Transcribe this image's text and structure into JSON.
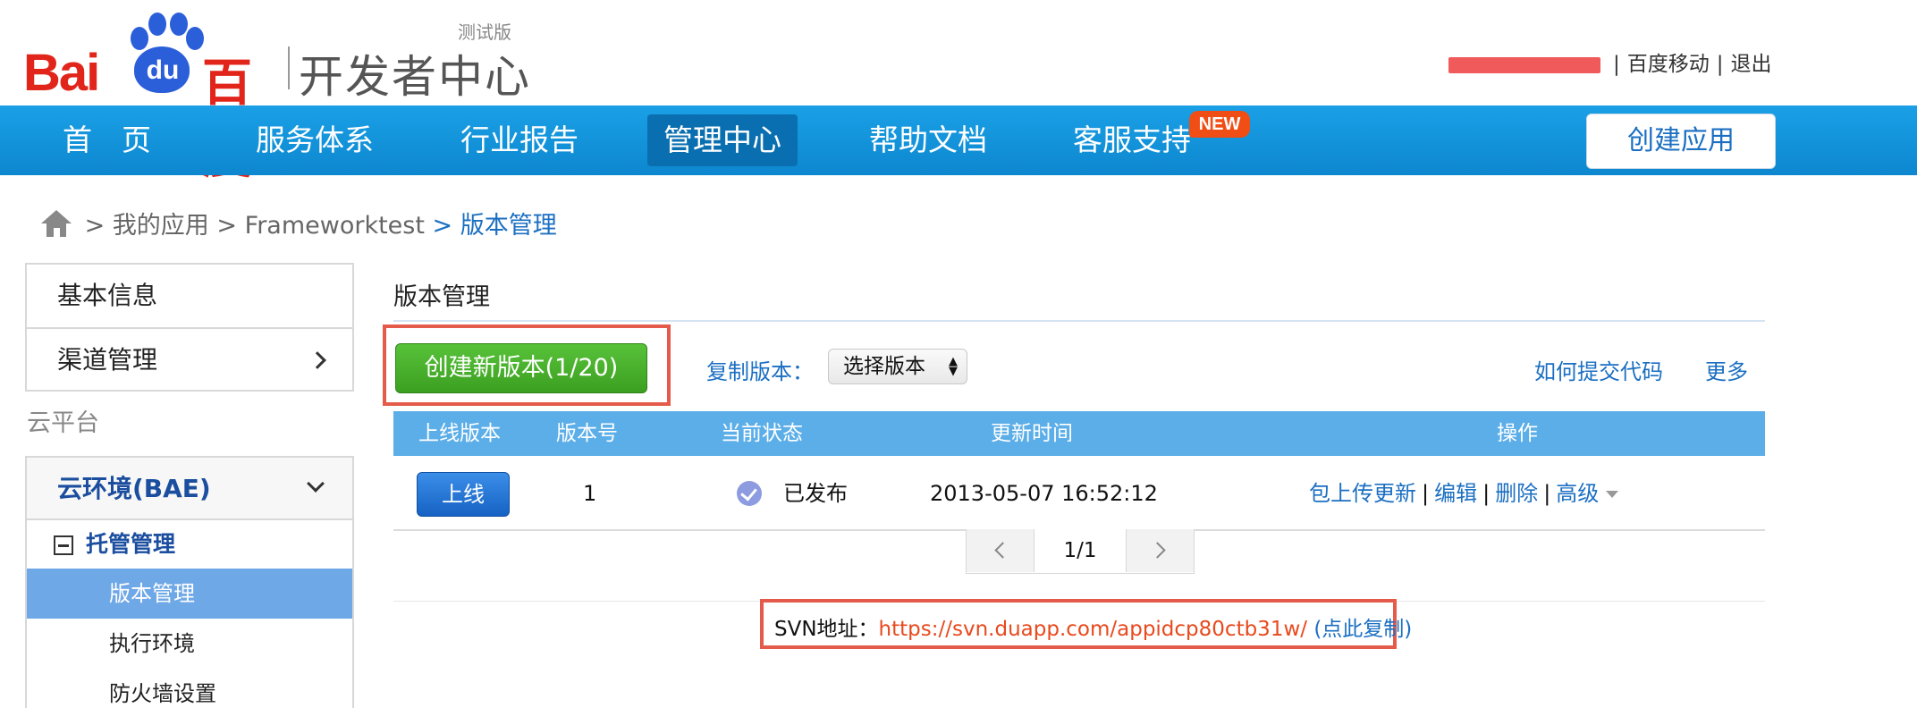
{
  "header": {
    "logo_bai": "Bai",
    "logo_du": "du",
    "logo_baidu_cn": "百度",
    "dev_center": "开发者中心",
    "beta_label": "测试版",
    "top_links": [
      "百度移动",
      "退出"
    ],
    "username_redacted": true
  },
  "nav": {
    "items": [
      {
        "label": "首　页"
      },
      {
        "label": "服务体系"
      },
      {
        "label": "行业报告"
      },
      {
        "label": "管理中心",
        "active": true
      },
      {
        "label": "帮助文档"
      },
      {
        "label": "客服支持"
      }
    ],
    "new_badge": "NEW",
    "create_app": "创建应用",
    "bar_color": "#0d87cf"
  },
  "breadcrumb": {
    "items": [
      "我的应用",
      "Frameworktest",
      "版本管理"
    ],
    "separator": ">"
  },
  "sidebar": {
    "basic_info": "基本信息",
    "channel_mgmt": "渠道管理",
    "section_cloud": "云平台",
    "bae": "云环境(BAE)",
    "hosting_group": "托管管理",
    "sub_items": [
      "版本管理",
      "执行环境",
      "防火墙设置"
    ],
    "active_sub": "版本管理"
  },
  "main": {
    "title": "版本管理",
    "create_btn": "创建新版本(1/20)",
    "copy_label": "复制版本：",
    "select_value": "选择版本",
    "how_to": "如何提交代码",
    "more": "更多",
    "columns": [
      "上线版本",
      "版本号",
      "当前状态",
      "更新时间",
      "操作"
    ],
    "rows": [
      {
        "online_btn": "上线",
        "version": "1",
        "status": "已发布",
        "updated": "2013-05-07 16:52:12",
        "ops": [
          "包上传更新",
          "编辑",
          "删除",
          "高级"
        ]
      }
    ],
    "pager": {
      "current": "1/1"
    },
    "svn_label": "SVN地址：",
    "svn_url": "https://svn.duapp.com/appidcp80ctb31w/",
    "svn_copy": "(点此复制)"
  },
  "colors": {
    "highlight": "#e45b4b",
    "link": "#1b6fc2",
    "create_green": "#3b9f20",
    "table_head": "#5caee8"
  }
}
